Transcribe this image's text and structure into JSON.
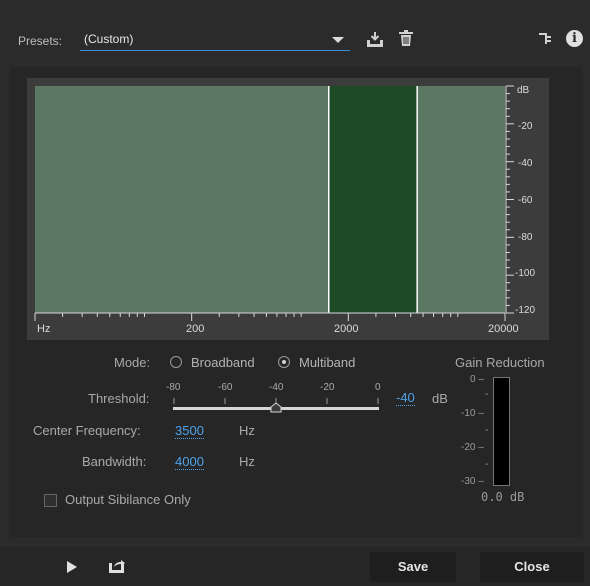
{
  "presets": {
    "label": "Presets:",
    "value": "(Custom)"
  },
  "icons": {
    "save_preset": "save-preset-icon",
    "delete_preset": "trash-icon",
    "routing": "routing-icon",
    "info": "info-icon",
    "play": "play-icon",
    "export": "export-icon"
  },
  "graph": {
    "x_unit": "Hz",
    "x_ticks": [
      "200",
      "2000",
      "20000"
    ],
    "db_unit": "dB",
    "db_ticks": [
      "-20",
      "-40",
      "-60",
      "-80",
      "-100",
      "-120"
    ],
    "band_low_hz": 1500,
    "band_high_hz": 5500,
    "colors": {
      "background": "#5b7862",
      "band": "#1e4a26",
      "band_edge": "#ffffff"
    }
  },
  "mode": {
    "label": "Mode:",
    "options": [
      "Broadband",
      "Multiband"
    ],
    "selected": "Multiband"
  },
  "threshold": {
    "label": "Threshold:",
    "scale": [
      "-80",
      "-60",
      "-40",
      "-20",
      "0"
    ],
    "value": "-40",
    "unit": "dB"
  },
  "center_frequency": {
    "label": "Center Frequency:",
    "value": "3500",
    "unit": "Hz"
  },
  "bandwidth": {
    "label": "Bandwidth:",
    "value": "4000",
    "unit": "Hz"
  },
  "gain_reduction": {
    "label": "Gain Reduction",
    "ticks": [
      "0 –",
      "-10 –",
      "-20 –",
      "-30 –"
    ],
    "readout": "0.0 dB"
  },
  "output_sibilance": {
    "label": "Output Sibilance Only",
    "checked": false
  },
  "buttons": {
    "save": "Save",
    "close": "Close"
  }
}
